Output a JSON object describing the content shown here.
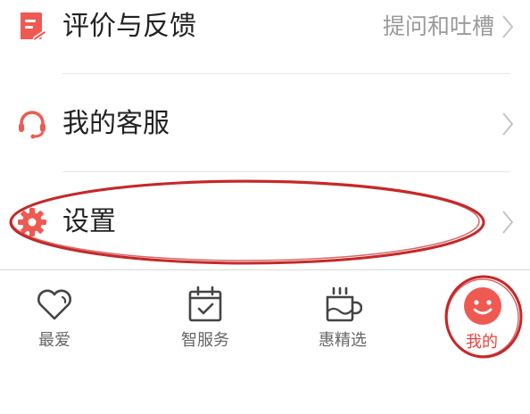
{
  "colors": {
    "accent": "#ee5a52",
    "active_tab": "#e8453c",
    "annotation": "#c62828",
    "icon_gray": "#444444",
    "label": "#222222",
    "hint": "#9a9a9a"
  },
  "menu": {
    "items": [
      {
        "label": "评价与反馈",
        "hint": "提问和吐槽",
        "icon": "feedback-icon"
      },
      {
        "label": "我的客服",
        "hint": "",
        "icon": "headset-icon"
      },
      {
        "label": "设置",
        "hint": "",
        "icon": "gear-icon"
      }
    ]
  },
  "tabbar": {
    "tabs": [
      {
        "label": "最爱",
        "icon": "heart-icon",
        "active": false
      },
      {
        "label": "智服务",
        "icon": "calendar-check-icon",
        "active": false
      },
      {
        "label": "惠精选",
        "icon": "coffee-cup-icon",
        "active": false
      },
      {
        "label": "我的",
        "icon": "smiley-face-icon",
        "active": true
      }
    ]
  }
}
